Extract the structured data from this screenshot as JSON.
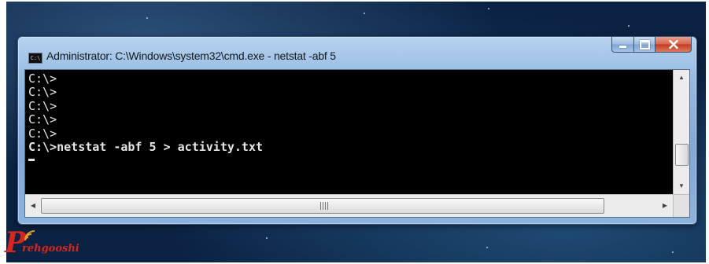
{
  "window": {
    "title": "Administrator: C:\\Windows\\system32\\cmd.exe - netstat  -abf 5",
    "app_icon_label": "C:\\"
  },
  "console": {
    "lines": [
      "C:\\>",
      "C:\\>",
      "C:\\>",
      "C:\\>",
      "C:\\>"
    ],
    "command_line": "C:\\>netstat -abf 5 > activity.txt"
  },
  "watermark": {
    "brand_letter": "P",
    "brand_text": "rehgooshi"
  },
  "colors": {
    "console_background": "#000000",
    "console_text": "#e6e6e6",
    "watermark": "#d7261e",
    "close_button": "#c43b1d"
  }
}
